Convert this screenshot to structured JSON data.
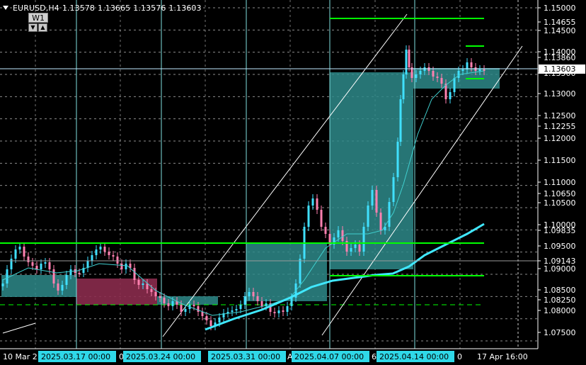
{
  "header": {
    "symbol": "EURUSD,H4",
    "open": "1.13578",
    "high": "1.13665",
    "low": "1.13576",
    "close": "1.13603"
  },
  "period_badge": {
    "label": "W1",
    "down_glyph": "▼",
    "up_glyph": "▲"
  },
  "colors": {
    "background": "#000000",
    "bull_candle": "#40e0ff",
    "bear_candle": "#ff80b0",
    "ma_fast": "#40d0d0",
    "ma_slow": "#40e8ff",
    "level_line": "#00ff00",
    "zone_fill": "#2e8a8a",
    "bear_zone_fill": "#8a2b4d",
    "grid": "#ffffff",
    "vline": "#7fe0e0",
    "axis_tag": "#2fd8e8",
    "price_box": "#ffffff"
  },
  "price_axis": {
    "labels": [
      "1.15000",
      "1.14655",
      "1.14500",
      "1.14000",
      "1.13860",
      "1.13500",
      "1.13000",
      "1.12500",
      "1.12255",
      "1.12000",
      "1.11500",
      "1.11000",
      "1.10650",
      "1.10500",
      "1.10000",
      "1.09835",
      "1.09500",
      "1.09143",
      "1.09000",
      "1.08500",
      "1.08250",
      "1.08000",
      "1.07500"
    ],
    "current_price": "1.13603",
    "current_label": "1.13603"
  },
  "time_axis": {
    "plain_labels": [
      "10 Mar 2",
      "0",
      "Ap",
      "6",
      "0",
      "17 Apr 16:00"
    ],
    "tags": [
      "2025.03.17 00:00",
      "2025.03.24 00:00",
      "2025.03.31 00:00",
      "2025.04.07 00:00",
      "2025.04.14 00:00"
    ]
  }
}
